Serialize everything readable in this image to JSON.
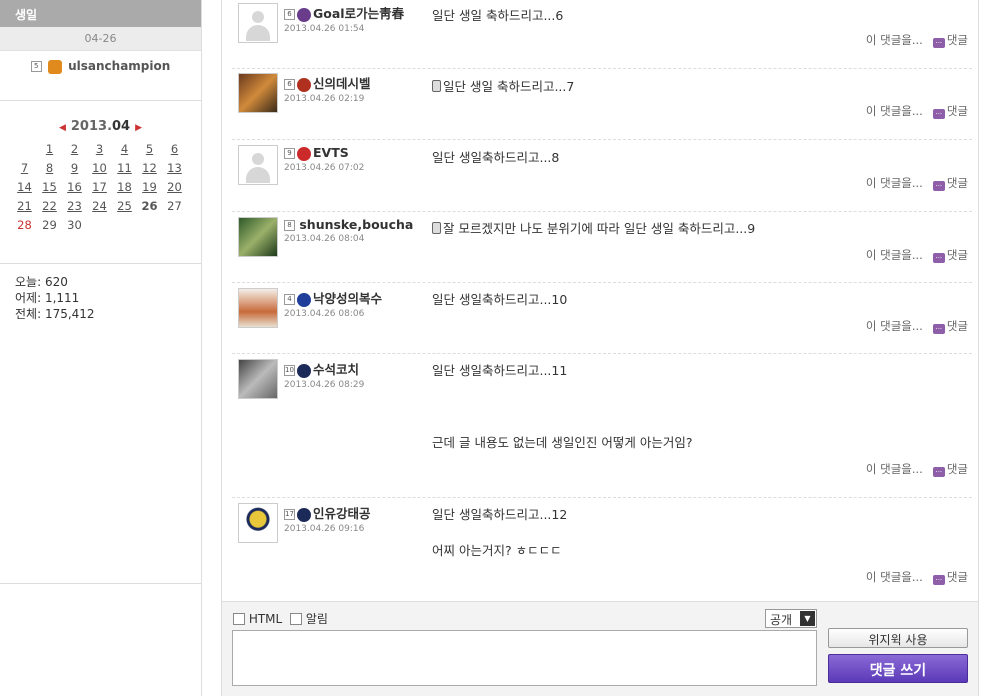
{
  "sidebar": {
    "birthday_title": "생일",
    "birthday_date": "04-26",
    "birthday_user_level": "5",
    "birthday_user": "ulsanchampion",
    "calendar": {
      "prev": "◀",
      "next": "▶",
      "year": "2013.",
      "month": "04",
      "weeks": [
        [
          "",
          "1",
          "2",
          "3",
          "4",
          "5",
          "6"
        ],
        [
          "7",
          "8",
          "9",
          "10",
          "11",
          "12",
          "13"
        ],
        [
          "14",
          "15",
          "16",
          "17",
          "18",
          "19",
          "20"
        ],
        [
          "21",
          "22",
          "23",
          "24",
          "25",
          "26",
          "27"
        ],
        [
          "28",
          "29",
          "30",
          "",
          "",
          "",
          ""
        ]
      ]
    },
    "counter": {
      "today": "오늘: 620",
      "yesterday": "어제: 1,111",
      "total": "전체: 175,412"
    }
  },
  "comments": [
    {
      "level": "6",
      "author": "Goal로가는靑春",
      "date": "2013.04.26 01:54",
      "text": "일단 생일 축하드리고...6",
      "text2": "",
      "mobile": false,
      "avatar": "default",
      "emblem": "#6a3c8c"
    },
    {
      "level": "6",
      "author": "신의데시벨",
      "date": "2013.04.26 02:19",
      "text": "일단 생일 축하드리고...7",
      "text2": "",
      "mobile": true,
      "avatar": "photo",
      "emblem": "#b03020"
    },
    {
      "level": "9",
      "author": "EVTS",
      "date": "2013.04.26 07:02",
      "text": "일단 생일축하드리고...8",
      "text2": "",
      "mobile": false,
      "avatar": "default",
      "emblem": "#cc2a2a"
    },
    {
      "level": "8",
      "author": "shunske,boucha",
      "date": "2013.04.26 08:04",
      "text": "잘 모르겠지만 나도 분위기에 따라 일단 생일 축하드리고...9",
      "text2": "",
      "mobile": true,
      "avatar": "photo",
      "emblem": ""
    },
    {
      "level": "4",
      "author": "낙양성의복수",
      "date": "2013.04.26 08:06",
      "text": "일단 생일축하드리고...10",
      "text2": "",
      "mobile": false,
      "avatar": "photo",
      "emblem": "#1f3f9a"
    },
    {
      "level": "10",
      "author": "수석코치",
      "date": "2013.04.26 08:29",
      "text": "일단 생일축하드리고...11",
      "text2": "근데 글 내용도 없는데 생일인진 어떻게 아는거임?",
      "mobile": false,
      "avatar": "photo",
      "emblem": "#1c2a5a"
    },
    {
      "level": "17",
      "author": "인유강태공",
      "date": "2013.04.26 09:16",
      "text": "일단 생일축하드리고...12",
      "text2": "어찌 아는거지? ㅎㄷㄷㄷ",
      "mobile": false,
      "avatar": "logo",
      "emblem": "#1c2a5a"
    }
  ],
  "comment_actions": {
    "reply_to": "이 댓글을...",
    "reply": "댓글"
  },
  "form": {
    "html_label": "HTML",
    "notify_label": "알림",
    "visibility": "공개",
    "widget_button": "위지윅 사용",
    "submit_button": "댓글 쓰기"
  }
}
